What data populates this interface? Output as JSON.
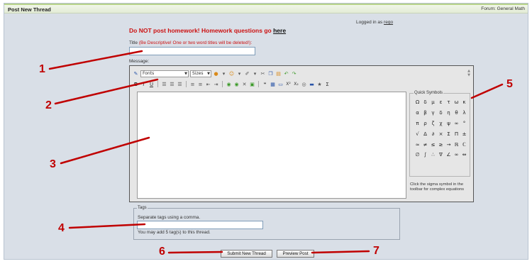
{
  "header": {
    "title": "Post New Thread",
    "forum": "Forum: General Math"
  },
  "login": {
    "text": "Logged in as",
    "user": "rego"
  },
  "warning": {
    "text": "Do NOT post homework! Homework questions go",
    "link": "here"
  },
  "title_field": {
    "label": "Title",
    "hint": "(Be Descriptive! One or two word titles will be deleted!):",
    "value": ""
  },
  "message": {
    "label": "Message:",
    "toolbar": {
      "font_select": "Fonts",
      "size_select": "Sizes",
      "bold": "B",
      "italic": "I",
      "underline": "U",
      "sigma": "Σ",
      "subscript": "X₂",
      "superscript": "X²"
    },
    "body": ""
  },
  "quick_symbols": {
    "legend": "Quick Symbols",
    "symbols": [
      "Ω",
      "δ",
      "μ",
      "ε",
      "τ",
      "ω",
      "κ",
      "α",
      "β",
      "γ",
      "δ",
      "η",
      "θ",
      "λ",
      "π",
      "ρ",
      "ζ",
      "χ",
      "ψ",
      "∞",
      "°",
      "√",
      "Δ",
      "∂",
      "×",
      "Σ",
      "Π",
      "±",
      "≈",
      "≠",
      "≤",
      "≥",
      "→",
      "ℝ",
      "ℂ",
      "∅",
      "∫",
      "∴",
      "∇",
      "∠",
      "∞",
      "⇔"
    ],
    "note": "Click the sigma symbol in the toolbar for complex equations"
  },
  "tags": {
    "legend": "Tags",
    "hint": "Separate tags using a comma.",
    "value": "",
    "note": "You may add 5 tag(s) to this thread."
  },
  "buttons": {
    "submit": "Submit New Thread",
    "preview": "Preview Post"
  },
  "annotations": {
    "labels": [
      "1",
      "2",
      "3",
      "4",
      "5",
      "6",
      "7"
    ],
    "color": "#c00000"
  },
  "colors": {
    "warning": "#cc1111",
    "page_bg": "#d9dfe7",
    "editor_bg": "#e6e6e6"
  }
}
